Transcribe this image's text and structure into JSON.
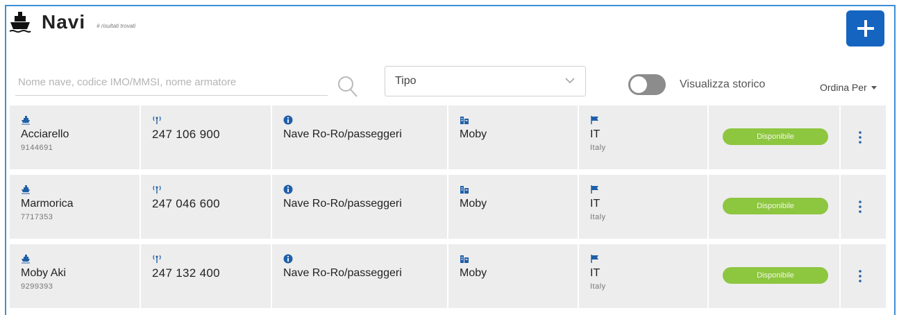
{
  "header": {
    "title": "Navi",
    "subtitle": "# risultati trovati",
    "icon": "ship-icon"
  },
  "toolbar": {
    "add_icon": "plus-icon",
    "search_placeholder": "Nome nave, codice IMO/MMSI, nome armatore",
    "search_value": "",
    "type_select_value": "Tipo",
    "history_toggle_label": "Visualizza storico",
    "history_toggle_on": false,
    "sort_label": "Ordina Per"
  },
  "colors": {
    "accent": "#1565c0",
    "status_available": "#8dc63f",
    "row_bg": "#ededed",
    "icon_blue": "#1f5fa8"
  },
  "ships": [
    {
      "name": "Acciarello",
      "imo": "9144691",
      "mmsi": "247 106 900",
      "type": "Nave Ro-Ro/passeggeri",
      "owner": "Moby",
      "flag_code": "IT",
      "flag_country": "Italy",
      "status": "Disponibile"
    },
    {
      "name": "Marmorica",
      "imo": "7717353",
      "mmsi": "247 046 600",
      "type": "Nave Ro-Ro/passeggeri",
      "owner": "Moby",
      "flag_code": "IT",
      "flag_country": "Italy",
      "status": "Disponibile"
    },
    {
      "name": "Moby Aki",
      "imo": "9299393",
      "mmsi": "247 132 400",
      "type": "Nave Ro-Ro/passeggeri",
      "owner": "Moby",
      "flag_code": "IT",
      "flag_country": "Italy",
      "status": "Disponibile"
    }
  ]
}
